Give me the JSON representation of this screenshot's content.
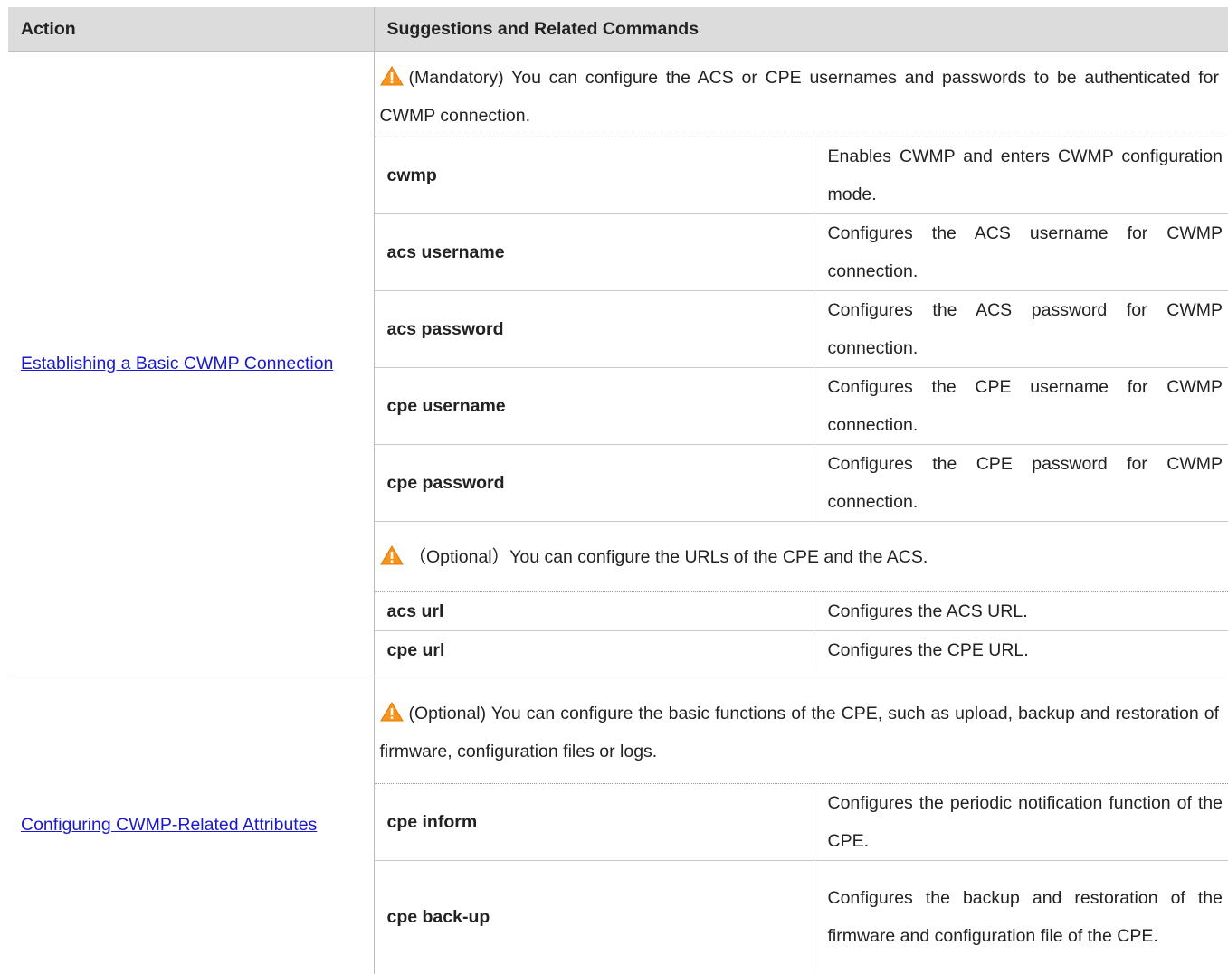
{
  "header": {
    "action": "Action",
    "suggestions": "Suggestions and Related Commands"
  },
  "sections": [
    {
      "action_link": "Establishing a Basic CWMP Connection",
      "notes": [
        {
          "text": "(Mandatory) You can configure the ACS or CPE usernames and passwords to be authenticated for CWMP connection.",
          "commands": [
            {
              "cmd": "cwmp",
              "desc": "Enables CWMP and enters CWMP configuration mode."
            },
            {
              "cmd": "acs username",
              "desc": "Configures the ACS username for CWMP connection."
            },
            {
              "cmd": "acs password",
              "desc": "Configures the ACS password for CWMP connection."
            },
            {
              "cmd": "cpe username",
              "desc": "Configures the CPE username for CWMP connection."
            },
            {
              "cmd": "cpe password",
              "desc": "Configures the CPE password for CWMP connection."
            }
          ]
        },
        {
          "text": "（Optional）You can configure the URLs of the CPE and the ACS.",
          "commands": [
            {
              "cmd": "acs url",
              "desc": "Configures the ACS URL."
            },
            {
              "cmd": "cpe url",
              "desc": "Configures the CPE URL."
            }
          ]
        }
      ]
    },
    {
      "action_link": "Configuring CWMP-Related Attributes",
      "notes": [
        {
          "text": "(Optional) You can configure the basic functions of the CPE, such as upload, backup and restoration of firmware, configuration files or logs.",
          "commands": [
            {
              "cmd": "cpe inform",
              "desc": "Configures the periodic notification function of the CPE."
            },
            {
              "cmd": "cpe back-up",
              "desc": "Configures the backup and restoration of the firmware and configuration file of the CPE."
            }
          ]
        }
      ]
    }
  ],
  "colors": {
    "header_bg": "#dcdcdc",
    "link": "#1a1acc",
    "warning_fill": "#f7941d"
  },
  "icons": {
    "warning": "warning-triangle-icon"
  }
}
